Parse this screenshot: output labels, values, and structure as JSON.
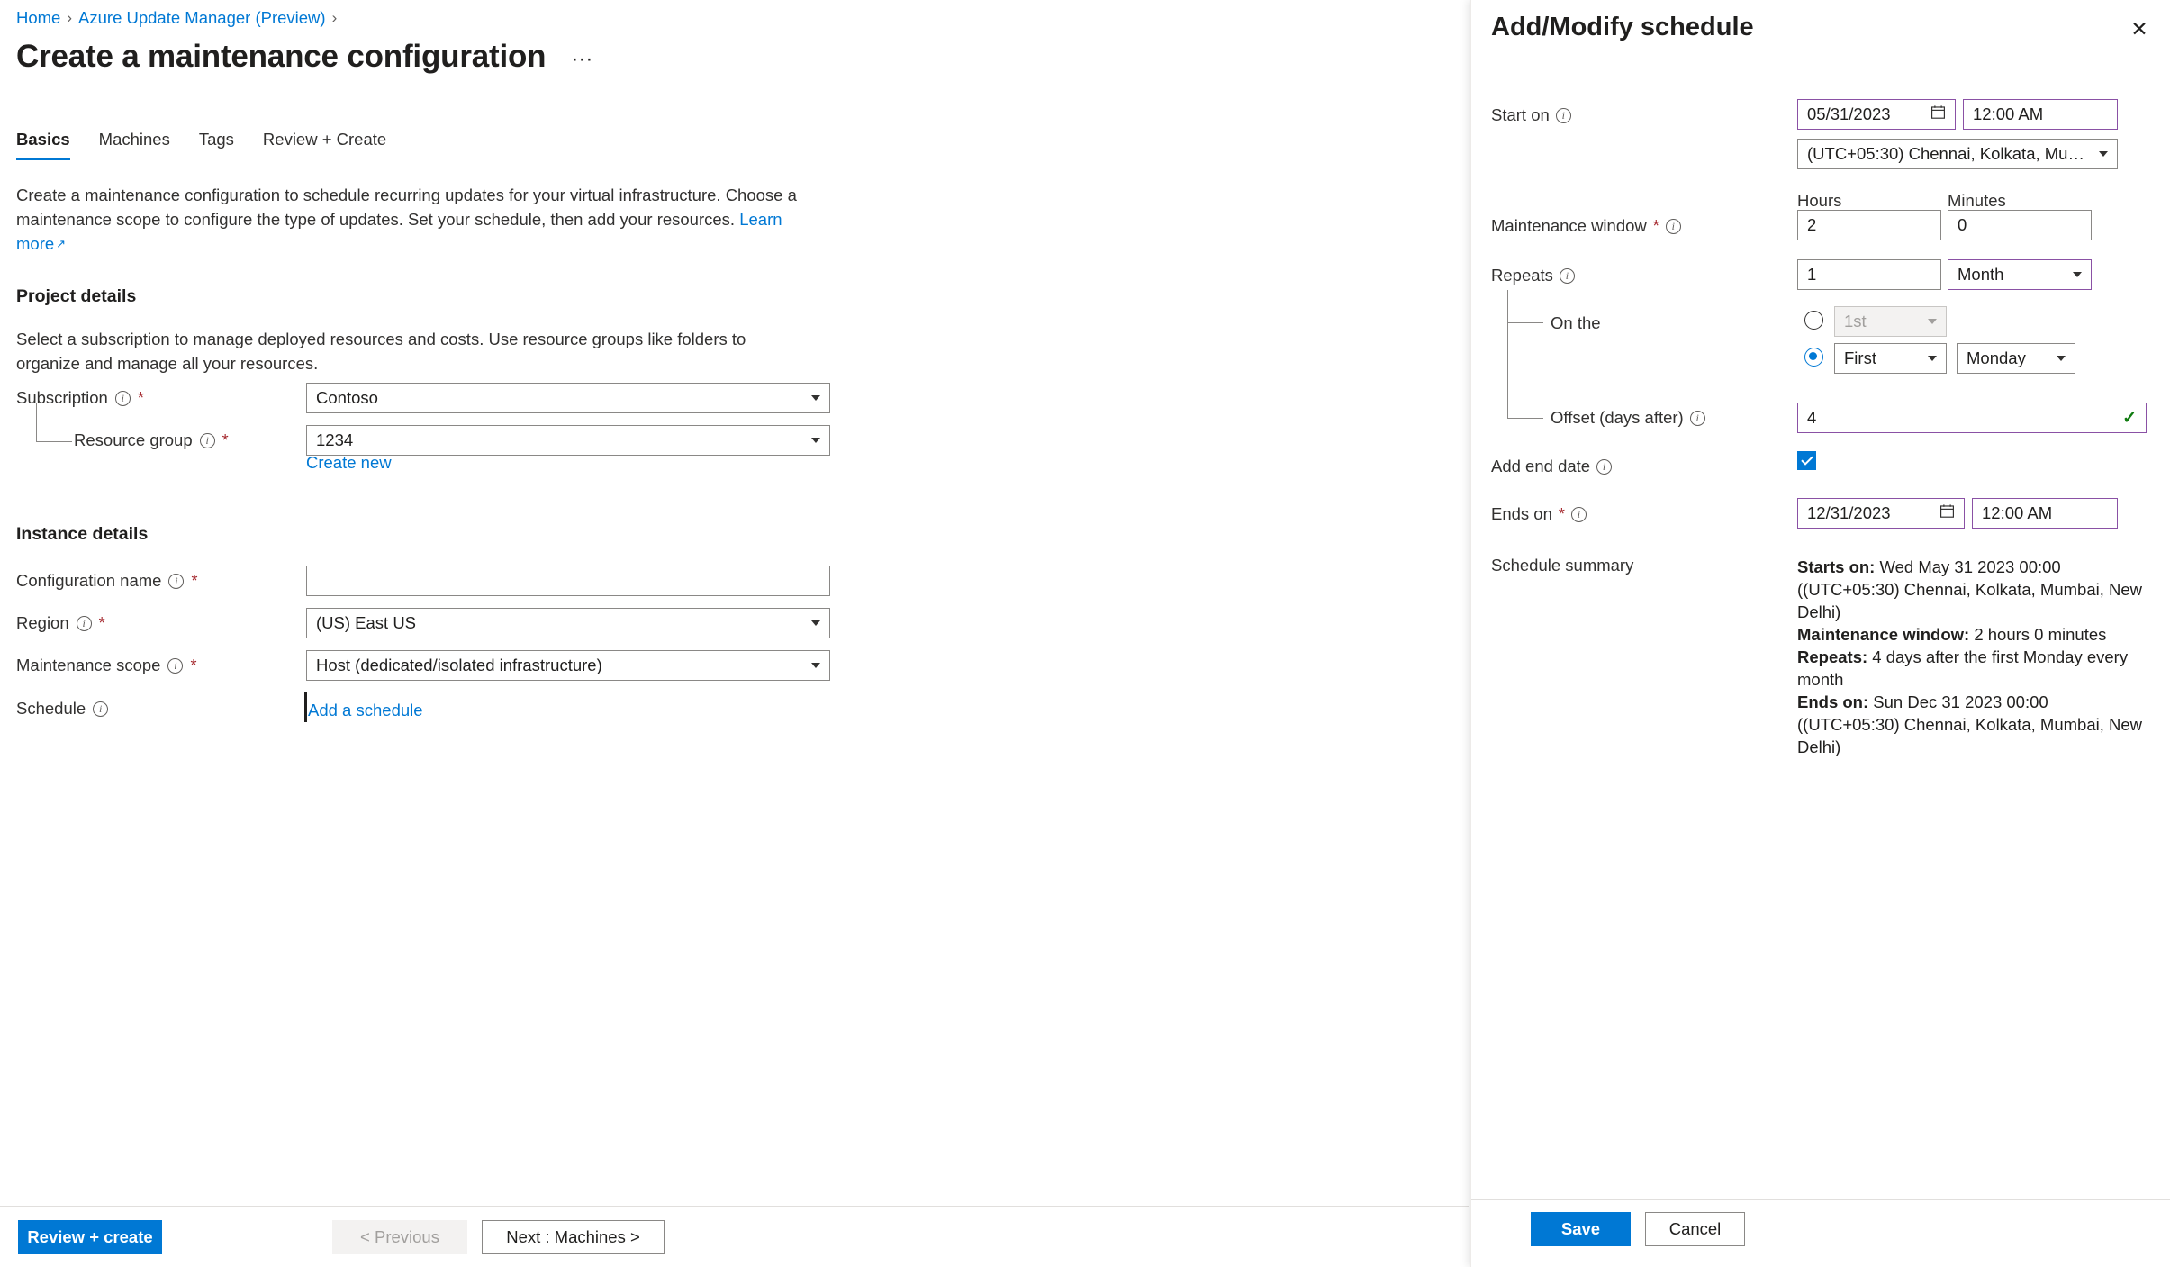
{
  "breadcrumb": {
    "items": [
      "Home",
      "Azure Update Manager (Preview)"
    ],
    "separator": "›"
  },
  "header": {
    "title": "Create a maintenance configuration",
    "more_label": "···"
  },
  "tabs": [
    {
      "label": "Basics",
      "active": true
    },
    {
      "label": "Machines",
      "active": false
    },
    {
      "label": "Tags",
      "active": false
    },
    {
      "label": "Review + Create",
      "active": false
    }
  ],
  "intro": {
    "text": "Create a maintenance configuration to schedule recurring updates for your virtual infrastructure. Choose a maintenance scope to configure the type of updates. Set your schedule, then add your resources.",
    "learn_more": "Learn more",
    "external_icon": "↗"
  },
  "project_details": {
    "heading": "Project details",
    "description": "Select a subscription to manage deployed resources and costs. Use resource groups like folders to organize and manage all your resources.",
    "subscription": {
      "label": "Subscription",
      "required": "*",
      "value": "Contoso"
    },
    "resource_group": {
      "label": "Resource group",
      "required": "*",
      "value": "1234",
      "create_new": "Create new"
    }
  },
  "instance_details": {
    "heading": "Instance details",
    "configuration_name": {
      "label": "Configuration name",
      "required": "*",
      "value": "",
      "placeholder": ""
    },
    "region": {
      "label": "Region",
      "required": "*",
      "value": "(US) East US"
    },
    "maintenance_scope": {
      "label": "Maintenance scope",
      "required": "*",
      "value": "Host (dedicated/isolated infrastructure)"
    },
    "schedule": {
      "label": "Schedule",
      "add_link": "Add a schedule"
    }
  },
  "footer": {
    "review_create": "Review + create",
    "previous": "< Previous",
    "next": "Next : Machines >"
  },
  "panel": {
    "title": "Add/Modify schedule",
    "close_icon": "✕",
    "start_on": {
      "label": "Start on",
      "date": "05/31/2023",
      "time": "12:00 AM",
      "timezone": "(UTC+05:30) Chennai, Kolkata, Mumbai, N..."
    },
    "maintenance_window": {
      "label": "Maintenance window",
      "required": "*",
      "hours_header": "Hours",
      "minutes_header": "Minutes",
      "hours": "2",
      "minutes": "0"
    },
    "repeats": {
      "label": "Repeats",
      "interval": "1",
      "unit": "Month",
      "on_the_label": "On the",
      "day_of_month": "1st",
      "day_of_month_selected": false,
      "ordinal": "First",
      "weekday": "Monday",
      "weekday_selected": true
    },
    "offset": {
      "label": "Offset (days after)",
      "value": "4",
      "valid_icon": "✓"
    },
    "add_end_date": {
      "label": "Add end date",
      "checked": true
    },
    "ends_on": {
      "label": "Ends on",
      "required": "*",
      "date": "12/31/2023",
      "time": "12:00 AM"
    },
    "schedule_summary": {
      "label": "Schedule summary",
      "lines": [
        {
          "key": "Starts on:",
          "value": " Wed May 31 2023 00:00 ((UTC+05:30) Chennai, Kolkata, Mumbai, New Delhi)"
        },
        {
          "key": "Maintenance window:",
          "value": " 2 hours 0 minutes"
        },
        {
          "key": "Repeats:",
          "value": " 4 days after the first Monday every month"
        },
        {
          "key": "Ends on:",
          "value": " Sun Dec 31 2023 00:00 ((UTC+05:30) Chennai, Kolkata, Mumbai, New Delhi)"
        }
      ]
    },
    "footer": {
      "save": "Save",
      "cancel": "Cancel"
    }
  },
  "colors": {
    "accent_blue": "#0078d4",
    "link_blue": "#0078d4",
    "required_red": "#a4262c",
    "focus_purple": "#8a51a5",
    "valid_green": "#107c10",
    "border_gray": "#8a8886"
  }
}
